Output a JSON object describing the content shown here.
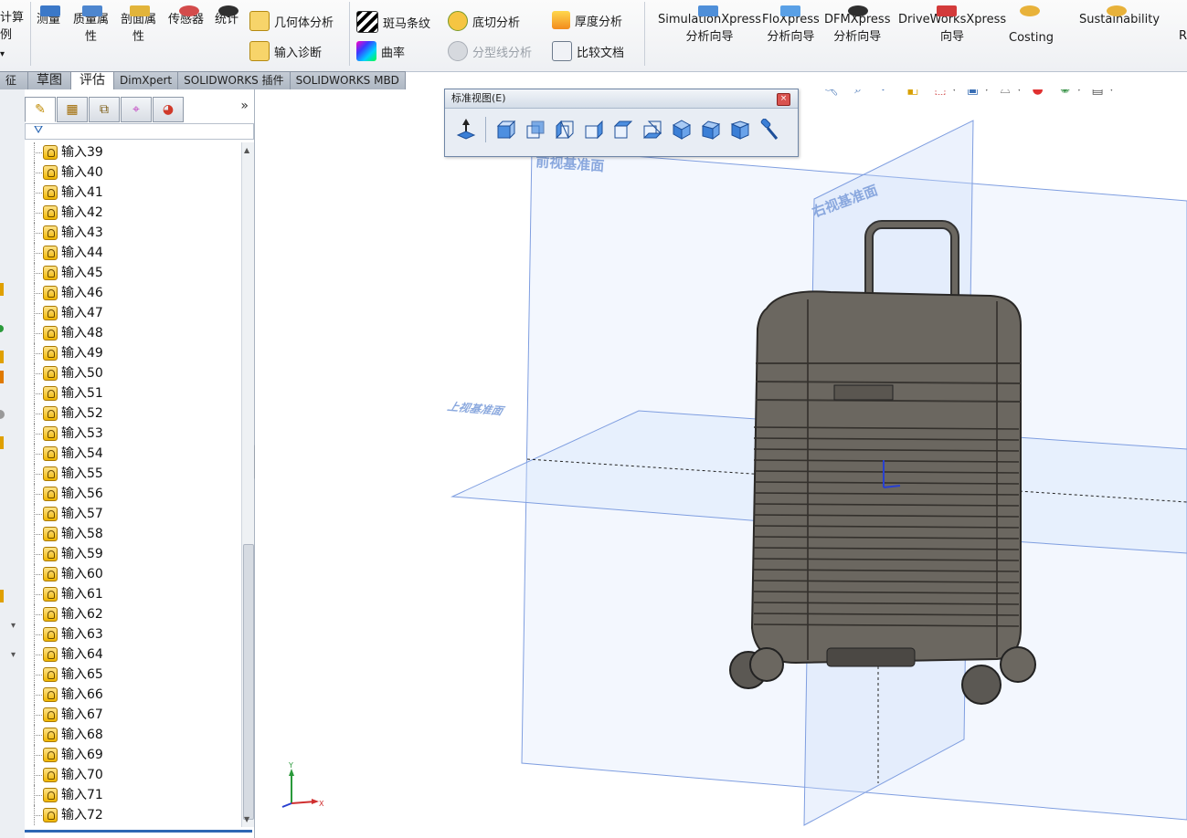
{
  "ribbon": {
    "left_cut_1": "计算",
    "left_cut_2": "例",
    "measure": "测量",
    "mass_props": [
      "质量属",
      "性"
    ],
    "section_props": [
      "剖面属",
      "性"
    ],
    "sensor": "传感器",
    "stats": "统计",
    "geometry_analysis": "几何体分析",
    "import_diag": "输入诊断",
    "zebra": "斑马条纹",
    "curvature": "曲率",
    "undercut": "底切分析",
    "parting": "分型线分析",
    "thickness": "厚度分析",
    "compare": "比较文档",
    "simxpress": [
      "SimulationXpress",
      "分析向导"
    ],
    "floxpress": [
      "FloXpress",
      "分析向导"
    ],
    "dfmxpress": [
      "DFMXpress",
      "分析向导"
    ],
    "driveworks": [
      "DriveWorksXpress",
      "向导"
    ],
    "costing": "Costing",
    "sustainability": "Sustainability",
    "right_cut": "R"
  },
  "tabs": [
    "征",
    "草图",
    "评估",
    "DimXpert",
    "SOLIDWORKS 插件",
    "SOLIDWORKS MBD"
  ],
  "active_tab": "评估",
  "panel": {
    "chevron": "»",
    "items": [
      "输入39",
      "输入40",
      "输入41",
      "输入42",
      "输入43",
      "输入44",
      "输入45",
      "输入46",
      "输入47",
      "输入48",
      "输入49",
      "输入50",
      "输入51",
      "输入52",
      "输入53",
      "输入54",
      "输入55",
      "输入56",
      "输入57",
      "输入58",
      "输入59",
      "输入60",
      "输入61",
      "输入62",
      "输入63",
      "输入64",
      "输入65",
      "输入66",
      "输入67",
      "输入68",
      "输入69",
      "输入70",
      "输入71",
      "输入72"
    ]
  },
  "floating_toolbar": {
    "title": "标准视图(E)",
    "close": "×"
  },
  "viewport": {
    "front_plane": "前视基准面",
    "right_plane": "右视基准面",
    "top_plane": "上视基准面",
    "axis_x": "X",
    "axis_y": "Y"
  },
  "colors": {
    "accent": "#2d66b3",
    "plane": "#7f9ee0",
    "plane_fill": "#e6eefc",
    "body": "#6b6760"
  }
}
